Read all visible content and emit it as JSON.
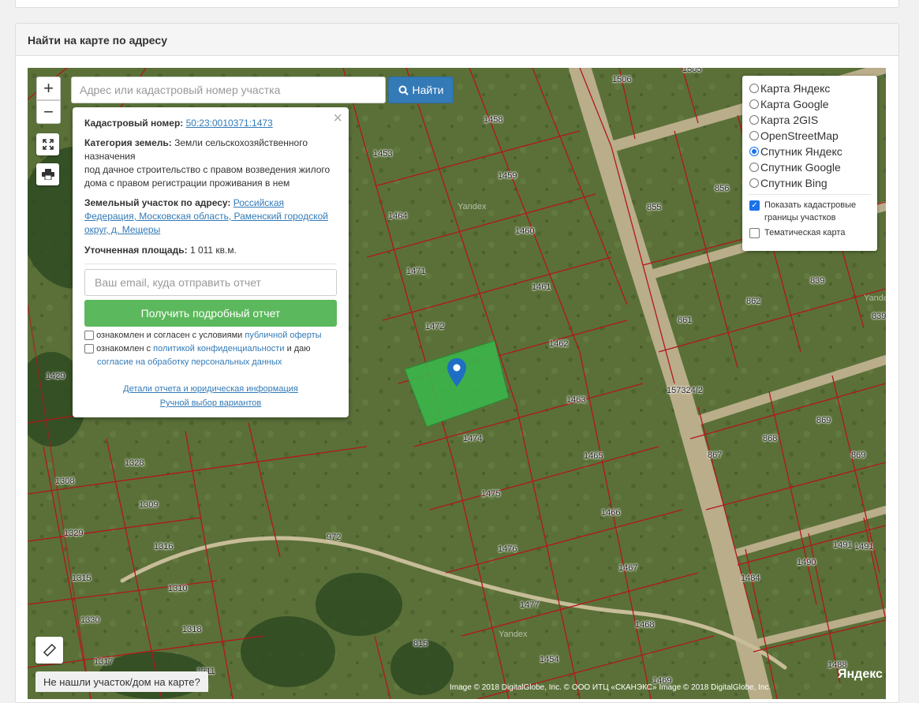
{
  "page": {
    "section_title": "Найти на карте по адресу"
  },
  "search": {
    "placeholder": "Адрес или кадастровый номер участка",
    "button_label": "Найти"
  },
  "zoom": {
    "in_label": "+",
    "out_label": "−"
  },
  "popup": {
    "close_label": "×",
    "cadastral_label": "Кадастровый номер:",
    "cadastral_value": "50:23:0010371:1473",
    "category_label": "Категория земель:",
    "category_value": "Земли сельскохозяйственного назначения",
    "purpose_value": "под дачное строительство с правом возведения жилого дома с правом регистрации проживания в нем",
    "address_label": "Земельный участок по адресу:",
    "address_value": "Российская Федерация, Московская область, Раменский городской округ, д. Мещеры",
    "area_label": "Уточненная площадь:",
    "area_value": "1 011 кв.м.",
    "email_placeholder": "Ваш email, куда отправить отчет",
    "report_button": "Получить подробный отчет",
    "consent1_text": "ознакомлен и согласен с условиями",
    "consent1_link": "публичной оферты",
    "consent2_text": "ознакомлен с",
    "consent2_link": "политикой конфиденциальности",
    "consent2_tail": "и даю",
    "consent2_link2": "согласие на обработку персональных данных",
    "details_link": "Детали отчета и юридическая информация",
    "manual_link": "Ручной выбор вариантов"
  },
  "layers": {
    "options": [
      "Карта Яндекс",
      "Карта Google",
      "Карта 2GIS",
      "OpenStreetMap",
      "Спутник Яндекс",
      "Спутник Google",
      "Спутник Bing"
    ],
    "selected": "Спутник Яндекс",
    "show_borders_label": "Показать кадастровые границы участков",
    "show_borders_checked": true,
    "thematic_label": "Тематическая карта",
    "thematic_checked": false
  },
  "map": {
    "selected_plot": "1473",
    "selected_plot_color": "#3cb54a",
    "not_found_label": "Не нашли участок/дом на карте?",
    "attribution": "Image © 2018 DigitalGlobe, Inc. © ООО ИТЦ «СКАНЭКС» Image © 2018 DigitalGlobe, Inc.",
    "provider_logo": "Яндекс",
    "watermark": "Yandex",
    "plot_numbers": [
      "1506",
      "1505",
      "1458",
      "1453",
      "1459",
      "1464",
      "1460",
      "1471",
      "1461",
      "1472",
      "1462",
      "1474",
      "1463",
      "1465",
      "1475",
      "1466",
      "1476",
      "1467",
      "1477",
      "1468",
      "1454",
      "815",
      "1469",
      "855",
      "856",
      "839",
      "862",
      "861",
      "157324/2",
      "867",
      "868",
      "869",
      "1484",
      "1490",
      "1491",
      "1488",
      "1328",
      "1308",
      "1309",
      "1329",
      "1316",
      "1315",
      "1310",
      "1330",
      "1318",
      "1317",
      "1311",
      "972",
      "1429",
      "839",
      "869",
      "1491"
    ]
  }
}
